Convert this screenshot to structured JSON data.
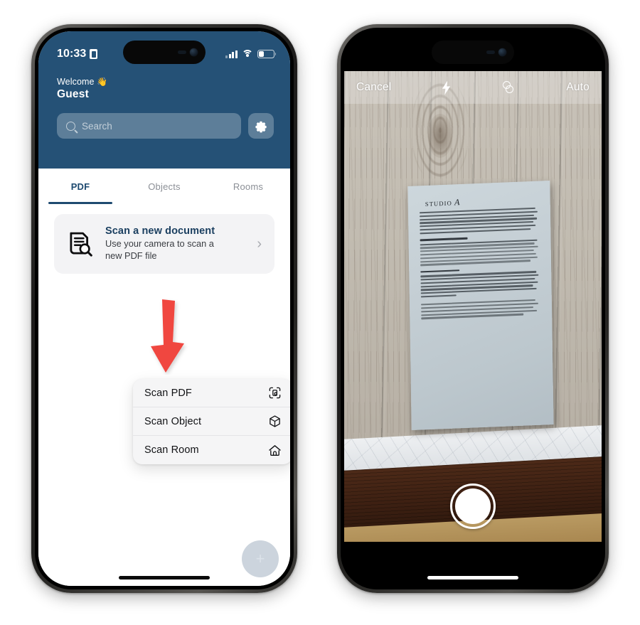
{
  "left_phone": {
    "status_bar": {
      "time": "10:33",
      "location_icon": "location-badge-icon",
      "signal_icon": "cellular-signal-icon",
      "wifi_icon": "wifi-icon",
      "battery_icon": "battery-icon"
    },
    "header": {
      "welcome_label": "Welcome",
      "wave_emoji": "👋",
      "user_name": "Guest",
      "background_color": "#255176"
    },
    "search": {
      "placeholder": "Search",
      "icon": "search-icon"
    },
    "settings_button": {
      "icon": "gear-icon",
      "label": ""
    },
    "tabs": [
      {
        "label": "PDF",
        "active": true
      },
      {
        "label": "Objects",
        "active": false
      },
      {
        "label": "Rooms",
        "active": false
      }
    ],
    "scan_card": {
      "icon": "document-scan-icon",
      "title": "Scan a new document",
      "subtitle": "Use your camera to scan a new PDF file",
      "chevron": "›"
    },
    "annotation": {
      "arrow_color": "#F0473F",
      "name": "red-down-arrow"
    },
    "context_menu": {
      "items": [
        {
          "label": "Scan PDF",
          "icon": "scan-document-icon"
        },
        {
          "label": "Scan Object",
          "icon": "cube-box-icon"
        },
        {
          "label": "Scan Room",
          "icon": "house-icon"
        }
      ]
    },
    "fab": {
      "icon": "plus-icon",
      "glyph": "+",
      "color": "#ccd4dd"
    }
  },
  "right_phone": {
    "camera_toolbar": {
      "cancel_label": "Cancel",
      "flash_icon": "flash-bolt-icon",
      "filter_icon": "color-filter-icon",
      "auto_label": "Auto"
    },
    "scene": {
      "surface": "wood-plank-table",
      "document": {
        "brand_prefix": "STUDIO",
        "brand_mark": "A",
        "body_language": "Chinese"
      }
    },
    "shutter_button": {
      "name": "camera-shutter-button"
    },
    "home_indicator": {
      "name": "home-indicator"
    }
  }
}
